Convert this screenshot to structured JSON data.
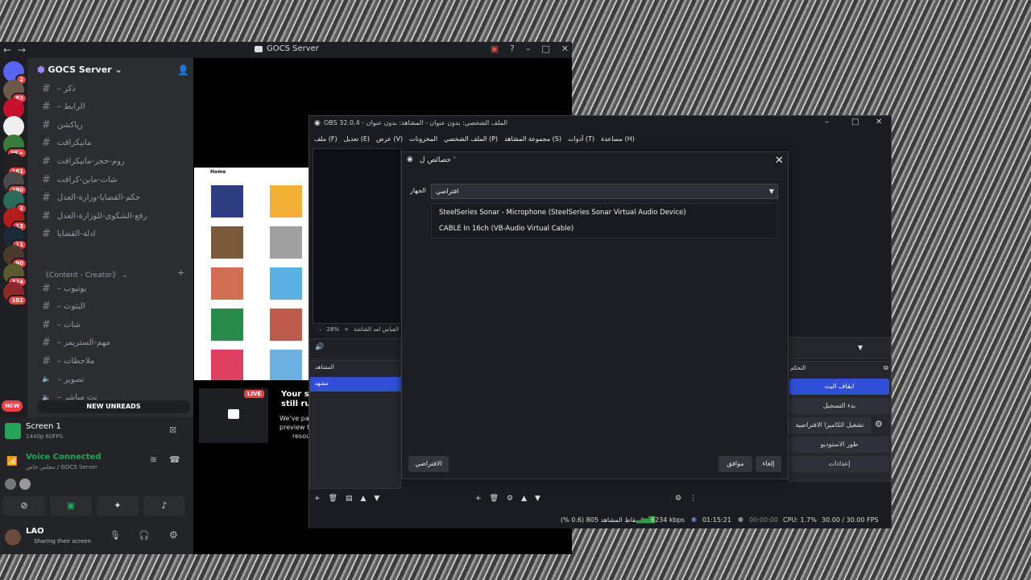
{
  "discord": {
    "window_title": "GOCS Server",
    "server_name": "GOCS Server",
    "channels": [
      {
        "label": "– ذكر",
        "icon": "hash"
      },
      {
        "label": "– الرابط",
        "icon": "hash"
      },
      {
        "label": "رياكشن",
        "icon": "hash"
      },
      {
        "label": "مانيكرافت",
        "icon": "hash"
      },
      {
        "label": "روم-حجز-مانيكرافت",
        "icon": "hash"
      },
      {
        "label": "شات-ماين-كرافت",
        "icon": "hash"
      },
      {
        "label": "حكم-القضايا-وزارة-العدل",
        "icon": "hash"
      },
      {
        "label": "رفع-الشكوى-للوزارة-العدل",
        "icon": "hash"
      },
      {
        "label": "ادلة-القضايا",
        "icon": "hash"
      }
    ],
    "category_label": "《Content - Creator》",
    "creator_channels": [
      {
        "label": "– يوتيوب",
        "icon": "hash"
      },
      {
        "label": "– البثوث",
        "icon": "hash"
      },
      {
        "label": "– شات",
        "icon": "hash"
      },
      {
        "label": "– مهم-الستريمر",
        "icon": "hash"
      },
      {
        "label": "– ملاحظات",
        "icon": "hash"
      },
      {
        "label": "– تصوير",
        "icon": "speaker"
      },
      {
        "label": "– بث مباشر",
        "icon": "speaker"
      }
    ],
    "guild_badges": [
      "2",
      "83",
      "",
      "",
      "3K+",
      "161",
      "280",
      "2",
      "13",
      "11",
      "90",
      "374",
      "102"
    ],
    "new_pill": "NEW",
    "new_unreads": "NEW UNREADS",
    "screen_share": {
      "title": "Screen 1",
      "quality": "1440p 60FPS"
    },
    "voice": {
      "status": "Voice Connected",
      "location": "مجلس خاص / GOCS Server"
    },
    "user": {
      "name": "LAO",
      "status": "Sharing their screen"
    },
    "live_badge": "LIVE",
    "stream_notice_line1": "Your st",
    "stream_notice_line2": "still ru",
    "stream_notice_line3": "We've pa",
    "stream_notice_line4": "preview to",
    "stream_notice_line5": "resou",
    "preview_heading": "Home",
    "accent": "#5865f2",
    "green": "#23a55a"
  },
  "obs": {
    "window_title": "OBS 32.0.4 - الملف الشخصي: بدون عنوان - المشاهد: بدون عنوان",
    "menu": [
      "ملف (F)",
      "تعديل (E)",
      "عرض (V)",
      "المخزونات",
      "الملف الشخصي (P)",
      "مجموعة المشاهد (S)",
      "أدوات (T)",
      "مساعدة (H)"
    ],
    "zoom": "28%",
    "no_source_label": "القياس لعد الشاشة",
    "scenes_header": "المشاهد",
    "scene_item": "مشهد",
    "controls_header": "التحكم",
    "controls": [
      "ايقاف البث",
      "بدء التسجيل",
      "تشغيل الكاميرا الافتراضية",
      "طور الاستوديو",
      "إعدادات"
    ],
    "status": {
      "dropped": "إسقاط المشاهد 805 (0.6 %)",
      "kbps": "6234 kbps",
      "stream_time": "01:15:21",
      "rec_time": "00:00:00",
      "cpu": "CPU: 1.7%",
      "fps": "30.00 / 30.00 FPS"
    },
    "accent": "#2f4fd6"
  },
  "dialog": {
    "title": "خصائص ل '",
    "device_label": "الجهاز",
    "device_value": "افتراضي",
    "options": [
      "SteelSeries Sonar - Microphone (SteelSeries Sonar Virtual Audio Device)",
      "CABLE In 16ch (VB-Audio Virtual Cable)"
    ],
    "defaults_button": "الافتراضي",
    "ok_button": "موافق",
    "cancel_button": "إلغاء"
  }
}
